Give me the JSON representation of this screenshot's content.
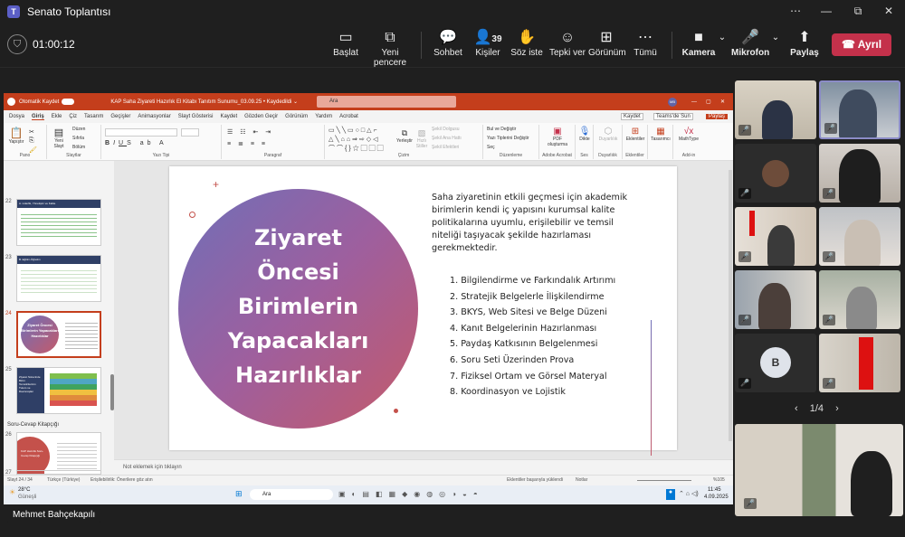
{
  "window": {
    "title": "Senato Toplantısı",
    "min": "…",
    "max": "⧉",
    "close": "✕",
    "more": "⋯"
  },
  "meeting": {
    "timer": "01:00:12",
    "toolbar": [
      {
        "label": "Başlat",
        "icon": "share-screen-icon"
      },
      {
        "label": "Yeni pencere",
        "icon": "new-window-icon"
      },
      {
        "label": "Sohbet",
        "icon": "chat-icon"
      },
      {
        "label": "Kişiler",
        "icon": "people-icon",
        "count": "39"
      },
      {
        "label": "Söz iste",
        "icon": "raise-hand-icon"
      },
      {
        "label": "Tepki ver",
        "icon": "react-icon"
      },
      {
        "label": "Görünüm",
        "icon": "view-icon"
      },
      {
        "label": "Tümü",
        "icon": "more-icon"
      },
      {
        "label": "Kamera",
        "icon": "camera-icon"
      },
      {
        "label": "Mikrofon",
        "icon": "mic-off-icon"
      },
      {
        "label": "Paylaş",
        "icon": "share-icon"
      }
    ],
    "leave_label": "Ayrıl"
  },
  "powerpoint": {
    "autosave": "Otomatik Kaydet",
    "filename": "KAP Saha Ziyareti Hazırlık El Kitabı Tanıtım Sunumu_03.09.25 • Kaydedildi ⌄",
    "search_placeholder": "Ara",
    "tabs": [
      "Dosya",
      "Giriş",
      "Ekle",
      "Çiz",
      "Tasarım",
      "Geçişler",
      "Animasyonlar",
      "Slayt Gösterisi",
      "Kaydet",
      "Gözden Geçir",
      "Görünüm",
      "Yardım",
      "Acrobat"
    ],
    "right_buttons": [
      "Kaydet",
      "Teams'de Sun",
      "Paylaş"
    ],
    "ribbon_groups": [
      "Pano",
      "Slaytlar",
      "Yazı Tipi",
      "Paragraf",
      "Çizim",
      "Düzenleme",
      "Adobe Acrobat",
      "Ses",
      "Duyarlılık",
      "Eklentiler",
      "Add-in"
    ],
    "ribbon_buttons": {
      "paste": "Yapıştır",
      "new_slide": "Yeni Slayt",
      "layout": "Düzen",
      "reset": "Sıfırla",
      "section": "Bölüm",
      "arrange": "Yerleştir",
      "quick_styles": "Hızlı Stiller",
      "fill": "Şekil Dolgusu",
      "outline": "Şekil Ana Hattı",
      "effects": "Şekil Efektleri",
      "find": "Bul ve Değiştir",
      "replace": "Yazı Tiplerini Değiştir",
      "select": "Seç",
      "pdf": "PDF oluşturma",
      "dictate": "Dikte",
      "sensitivity": "Duyarlılık",
      "addins": "Eklentiler",
      "designer": "Tasarımcı",
      "mathtype": "MathType"
    },
    "thumbnails": [
      {
        "num": "22",
        "title": "A. Liderlik, Yönetişim ve Kalite"
      },
      {
        "num": "23",
        "title": "B. Eğitim-Öğretim"
      },
      {
        "num": "24",
        "title": "Ziyaret Öncesi Birimlerin Yapacakları Hazırlıklar"
      },
      {
        "num": "25",
        "title": "Ziyaret Sürecinde Birim Temsilcilerinin Tutum ve Davranışları"
      },
      {
        "num": "26",
        "title": "KAP Hazırlık Soru-Cevap Kitapçığı"
      },
      {
        "num": "27",
        "title": ""
      }
    ],
    "section_label": "Soru-Cevap Kitapçığı",
    "slide": {
      "circle_lines": [
        "Ziyaret",
        "Öncesi",
        "Birimlerin",
        "Yapacakları",
        "Hazırlıklar"
      ],
      "intro": "Saha ziyaretinin etkili geçmesi için akademik birimlerin kendi iç yapısını kurumsal kalite politikalarına uyumlu, erişilebilir ve temsil niteliği taşıyacak şekilde hazırlaması gerekmektedir.",
      "items": [
        "1. Bilgilendirme ve Farkındalık Artırımı",
        "2. Stratejik Belgelerle İlişkilendirme",
        "3. BKYS, Web Sitesi ve Belge Düzeni",
        "4. Kanıt Belgelerinin Hazırlanması",
        "5. Paydaş Katkısının Belgelenmesi",
        "6. Soru Seti Üzerinden Prova",
        "7. Fiziksel Ortam ve Görsel Materyal",
        "8. Koordinasyon ve Lojistik"
      ]
    },
    "notes_placeholder": "Not eklemek için tıklayın",
    "status": {
      "slide": "Slayt 24 / 34",
      "language": "Türkçe (Türkiye)",
      "accessibility": "Erişilebilirlik: Önerilere göz atın",
      "addins_msg": "Eklentiler başarıyla yüklendi",
      "notes": "Notlar",
      "zoom": "%105"
    },
    "taskbar": {
      "weather_temp": "28°C",
      "weather_desc": "Güneşli",
      "search": "Ara",
      "time": "11:45",
      "date": "4.09.2025"
    }
  },
  "gallery": {
    "avatar_letter": "B",
    "pager": "1/4",
    "prev": "‹",
    "next": "›"
  },
  "speaker_name": "Mehmet Bahçekapılı"
}
